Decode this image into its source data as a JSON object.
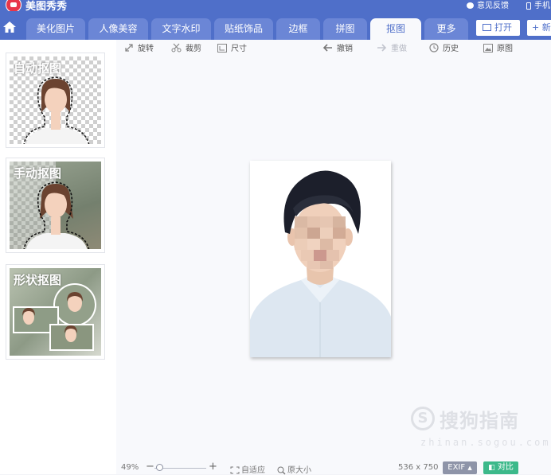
{
  "app": {
    "title": "美图秀秀"
  },
  "titlebar": {
    "feedback": "意见反馈",
    "phone": "手机"
  },
  "nav": {
    "tabs": [
      {
        "label": "美化图片",
        "active": false
      },
      {
        "label": "人像美容",
        "active": false
      },
      {
        "label": "文字水印",
        "active": false
      },
      {
        "label": "贴纸饰品",
        "active": false
      },
      {
        "label": "边框",
        "active": false
      },
      {
        "label": "拼图",
        "active": false
      },
      {
        "label": "抠图",
        "active": true
      },
      {
        "label": "更多",
        "active": false
      }
    ],
    "open_label": "打开",
    "new_label": "+ 新"
  },
  "sidebar": {
    "items": [
      {
        "label": "自动抠图"
      },
      {
        "label": "手动抠图"
      },
      {
        "label": "形状抠图"
      }
    ]
  },
  "toolbar": {
    "rotate": "旋转",
    "crop": "裁剪",
    "size": "尺寸",
    "undo": "撤销",
    "redo": "重做",
    "history": "历史",
    "original": "原图"
  },
  "watermark": {
    "text": "搜狗指南",
    "url": "zhinan.sogou.com"
  },
  "status": {
    "zoom": "49%",
    "zoom_fraction": 0.1,
    "fit": "自适应",
    "actual_size": "原大小",
    "dimensions": "536 x 750",
    "exif": "EXIF",
    "compare": "对比"
  },
  "colors": {
    "accent": "#4f6fc9",
    "tab_inactive": "#6b86d6",
    "compare_badge": "#3cb98a",
    "exif_badge": "#8e94a8"
  }
}
